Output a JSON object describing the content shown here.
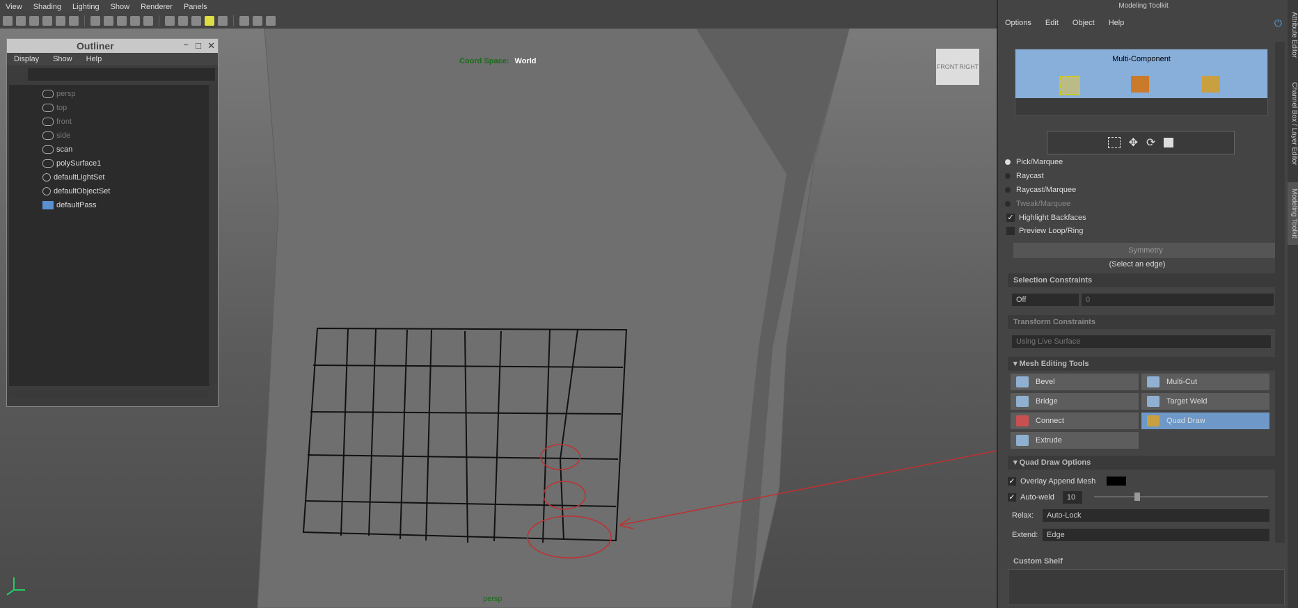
{
  "menubar": [
    "View",
    "Shading",
    "Lighting",
    "Show",
    "Renderer",
    "Panels"
  ],
  "viewport": {
    "coord_label": "Coord Space:",
    "coord_value": "World",
    "camera": "persp",
    "viewcube_front": "FRONT",
    "viewcube_right": "RIGHT"
  },
  "outliner": {
    "title": "Outliner",
    "menu": [
      "Display",
      "Show",
      "Help"
    ],
    "items": [
      {
        "label": "persp",
        "dim": true
      },
      {
        "label": "top",
        "dim": true
      },
      {
        "label": "front",
        "dim": true
      },
      {
        "label": "side",
        "dim": true
      },
      {
        "label": "scan",
        "dim": false
      },
      {
        "label": "polySurface1",
        "dim": false
      },
      {
        "label": "defaultLightSet",
        "dim": false
      },
      {
        "label": "defaultObjectSet",
        "dim": false
      },
      {
        "label": "defaultPass",
        "dim": false
      }
    ]
  },
  "toolkit": {
    "title": "Modeling Toolkit",
    "menu": [
      "Options",
      "Edit",
      "Object",
      "Help"
    ],
    "multi_component": "Multi-Component",
    "pick_modes": [
      {
        "label": "Pick/Marquee",
        "on": true
      },
      {
        "label": "Raycast",
        "on": false
      },
      {
        "label": "Raycast/Marquee",
        "on": false
      },
      {
        "label": "Tweak/Marquee",
        "on": false
      }
    ],
    "highlight_backfaces": "Highlight Backfaces",
    "preview_loop": "Preview Loop/Ring",
    "symmetry": "Symmetry",
    "select_edge": "(Select an edge)",
    "selection_constraints": "Selection Constraints",
    "sel_off": "Off",
    "sel_val": "0",
    "transform_constraints": "Transform Constraints",
    "using_live": "Using Live Surface",
    "mesh_editing_tools": "Mesh Editing Tools",
    "tools": [
      "Bevel",
      "Multi-Cut",
      "Bridge",
      "Target Weld",
      "Connect",
      "Quad Draw",
      "Extrude"
    ],
    "quad_draw_options": "Quad Draw Options",
    "overlay": "Overlay Append Mesh",
    "autoweld": "Auto-weld",
    "autoweld_val": "10",
    "relax_label": "Relax:",
    "relax_val": "Auto-Lock",
    "extend_label": "Extend:",
    "extend_val": "Edge",
    "custom_shelf": "Custom Shelf"
  },
  "side_tabs": [
    "Attribute Editor",
    "Channel Box / Layer Editor",
    "Modeling Toolkit"
  ]
}
